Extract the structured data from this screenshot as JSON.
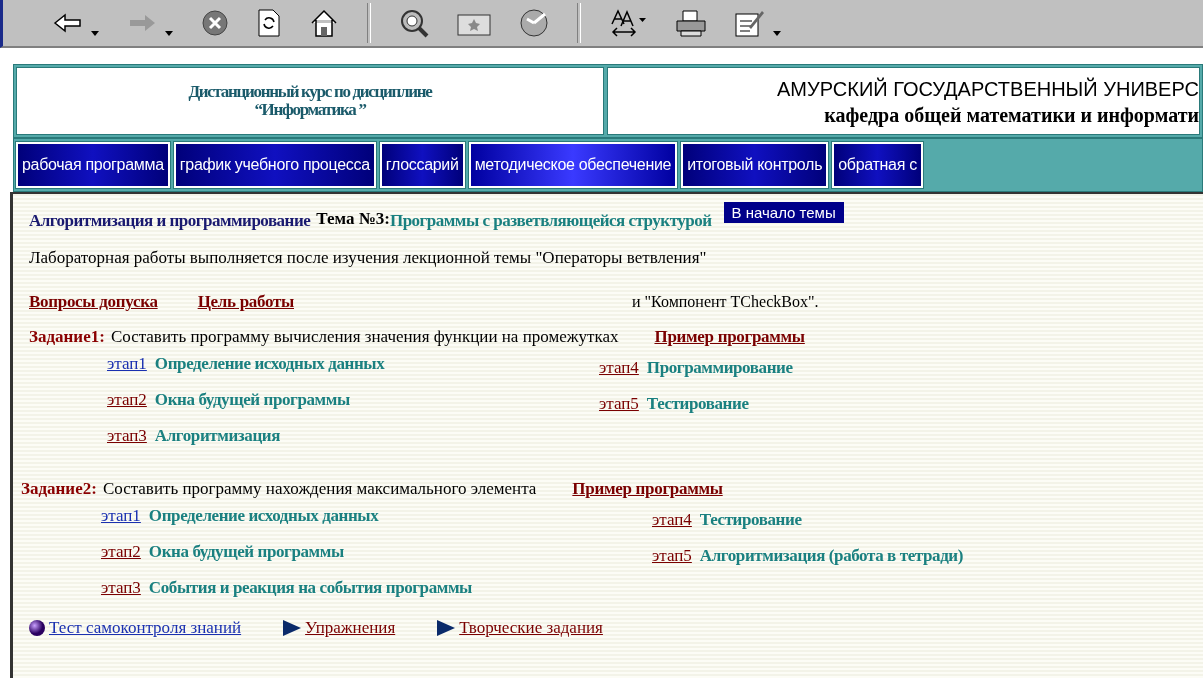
{
  "header": {
    "course_title": [
      "Дистанционный курс по дисциплине",
      "“Информатика ”"
    ],
    "university": "АМУРСКИЙ ГОСУДАРСТВЕННЫЙ УНИВЕРС",
    "department": "кафедра общей математики и информати"
  },
  "nav": [
    {
      "label": "рабочая программа",
      "selected": false
    },
    {
      "label": "график учебного процесса",
      "selected": false
    },
    {
      "label": "глоссарий",
      "selected": false
    },
    {
      "label": "методическое обеспечение",
      "selected": true
    },
    {
      "label": "итоговый контроль",
      "selected": false
    },
    {
      "label": "обратная с",
      "selected": false
    }
  ],
  "topic": {
    "section": "Алгоритмизация и программирование",
    "number": "Тема №3:",
    "title": "Программы с разветвляющейся структурой",
    "top_button": "В начало темы"
  },
  "intro": [
    "Лабораторная работы выполняется после изучения лекционной темы \"Операторы ветвления\"",
    "и \"Компонент TCheckBox\"."
  ],
  "links": [
    {
      "label": "Вопросы допуска"
    },
    {
      "label": "Цель работы"
    }
  ],
  "tasks": [
    {
      "label": "Задание1:",
      "text": "Составить программу вычисления значения функции на промежутках",
      "example": "Пример программы",
      "columns": [
        [
          {
            "link": "этап1",
            "title": "Определение исходных данных",
            "visited": false
          },
          {
            "link": "этап2",
            "title": "Окна будущей программы",
            "visited": true
          },
          {
            "link": "этап3",
            "title": "Алгоритмизация",
            "visited": true
          }
        ],
        [
          {
            "link": "этап4",
            "title": "Программирование",
            "visited": true
          },
          {
            "link": "этап5",
            "title": "Тестирование",
            "visited": true
          }
        ]
      ]
    },
    {
      "label": "Задание2:",
      "text": "Составить программу нахождения максимального элемента",
      "example": "Пример программы",
      "columns": [
        [
          {
            "link": "этап1",
            "title": "Определение исходных данных",
            "visited": false
          },
          {
            "link": "этап2",
            "title": "Окна будущей программы",
            "visited": true
          },
          {
            "link": "этап3",
            "title": "События и реакция на события программы",
            "visited": true
          }
        ],
        [
          {
            "link": "этап4",
            "title": "Тестирование",
            "visited": true
          },
          {
            "link": "этап5",
            "title": "Алгоритмизация (работа в тетради)",
            "visited": true
          }
        ]
      ]
    }
  ],
  "footer": [
    {
      "kind": "ball",
      "label": "Тест самоконтроля знаний",
      "visited": false
    },
    {
      "kind": "triangle",
      "label": "Упражнения",
      "visited": true
    },
    {
      "kind": "triangle",
      "label": "Творческие задания",
      "visited": true
    }
  ]
}
